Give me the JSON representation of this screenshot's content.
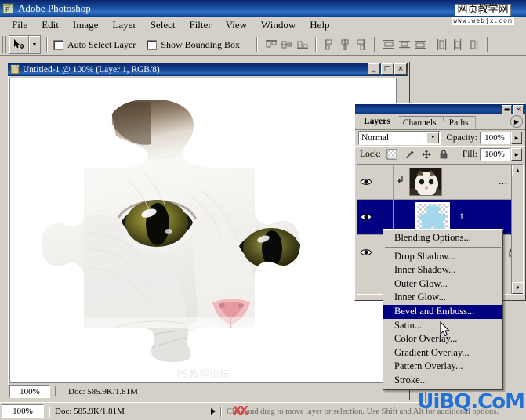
{
  "app": {
    "title": "Adobe Photoshop",
    "icon": "photoshop-icon"
  },
  "watermarks": {
    "top_cn": "网页教学网",
    "top_url": "www.webjx.com",
    "canvas": "PS教程论坛",
    "bottom": "UiBQ.CoM",
    "close_glyph": "×"
  },
  "menubar": {
    "items": [
      {
        "label": "File"
      },
      {
        "label": "Edit"
      },
      {
        "label": "Image"
      },
      {
        "label": "Layer"
      },
      {
        "label": "Select"
      },
      {
        "label": "Filter"
      },
      {
        "label": "View"
      },
      {
        "label": "Window"
      },
      {
        "label": "Help"
      }
    ]
  },
  "options_bar": {
    "tool": "move-tool",
    "tool_dropdown_glyph": "▼",
    "auto_select_layer": "Auto Select Layer",
    "show_bounding_box": "Show Bounding Box",
    "align_group_1": [
      "align-top-edges",
      "align-vertical-centers",
      "align-bottom-edges"
    ],
    "align_group_2": [
      "align-left-edges",
      "align-horizontal-centers",
      "align-right-edges"
    ],
    "distribute_group_1": [
      "distribute-top-edges",
      "distribute-vertical-centers",
      "distribute-bottom-edges"
    ],
    "distribute_group_2": [
      "distribute-left-edges",
      "distribute-horizontal-centers",
      "distribute-right-edges"
    ]
  },
  "document": {
    "title": "Untitled-1 @ 100% (Layer 1, RGB/8)",
    "minimize_glyph": "_",
    "maximize_glyph": "□",
    "close_glyph": "×",
    "zoom": "100%",
    "doc_info": "Doc: 585.9K/1.81M",
    "status_hint": "Click and drag to move layer or selection. Use Shift and Alt for additional options.",
    "status_arrow_glyph": "▶"
  },
  "status_bar": {
    "zoom": "100%",
    "doc_info": "Doc: 585.9K/1.81M",
    "hint": "Click and drag to move layer or selection. Use Shift and Alt for additional options."
  },
  "layers_palette": {
    "title_minimize_glyph": "▬",
    "title_close_glyph": "×",
    "menu_arrow_glyph": "▶",
    "tabs": [
      {
        "label": "Layers",
        "active": true
      },
      {
        "label": "Channels",
        "active": false
      },
      {
        "label": "Paths",
        "active": false
      }
    ],
    "blend_mode": "Normal",
    "blend_arrow_glyph": "▼",
    "opacity_label": "Opacity:",
    "opacity_value": "100%",
    "fill_label": "Fill:",
    "fill_value": "100%",
    "lock_label": "Lock:",
    "lock_icons": [
      "lock-transparency-icon",
      "lock-image-icon",
      "lock-position-icon",
      "lock-all-icon"
    ],
    "spinner_glyph": "▶",
    "scroll_up_glyph": "▲",
    "scroll_down_glyph": "▼",
    "layers": [
      {
        "name": "",
        "visible": true,
        "selected": false,
        "thumb": "cat-photo",
        "clipped": true,
        "extra": "…"
      },
      {
        "name": "1",
        "visible": true,
        "selected": true,
        "thumb": "transparent-shape"
      },
      {
        "name": "",
        "visible": true,
        "selected": false,
        "thumb": "background",
        "locked": true,
        "extra": "…"
      }
    ]
  },
  "context_menu": {
    "items": [
      {
        "label": "Blending Options...",
        "selected": false,
        "separator_after": true
      },
      {
        "label": "Drop Shadow...",
        "selected": false
      },
      {
        "label": "Inner Shadow...",
        "selected": false
      },
      {
        "label": "Outer Glow...",
        "selected": false
      },
      {
        "label": "Inner Glow...",
        "selected": false
      },
      {
        "label": "Bevel and Emboss...",
        "selected": true
      },
      {
        "label": "Satin...",
        "selected": false
      },
      {
        "label": "Color Overlay...",
        "selected": false
      },
      {
        "label": "Gradient Overlay...",
        "selected": false
      },
      {
        "label": "Pattern Overlay...",
        "selected": false
      },
      {
        "label": "Stroke...",
        "selected": false
      }
    ],
    "cursor": "arrow-cursor"
  },
  "colors": {
    "titlebar_blue": "#0a246a",
    "face": "#d4d0c8",
    "selection_blue": "#000080",
    "watermark_blue": "#1569d6"
  }
}
